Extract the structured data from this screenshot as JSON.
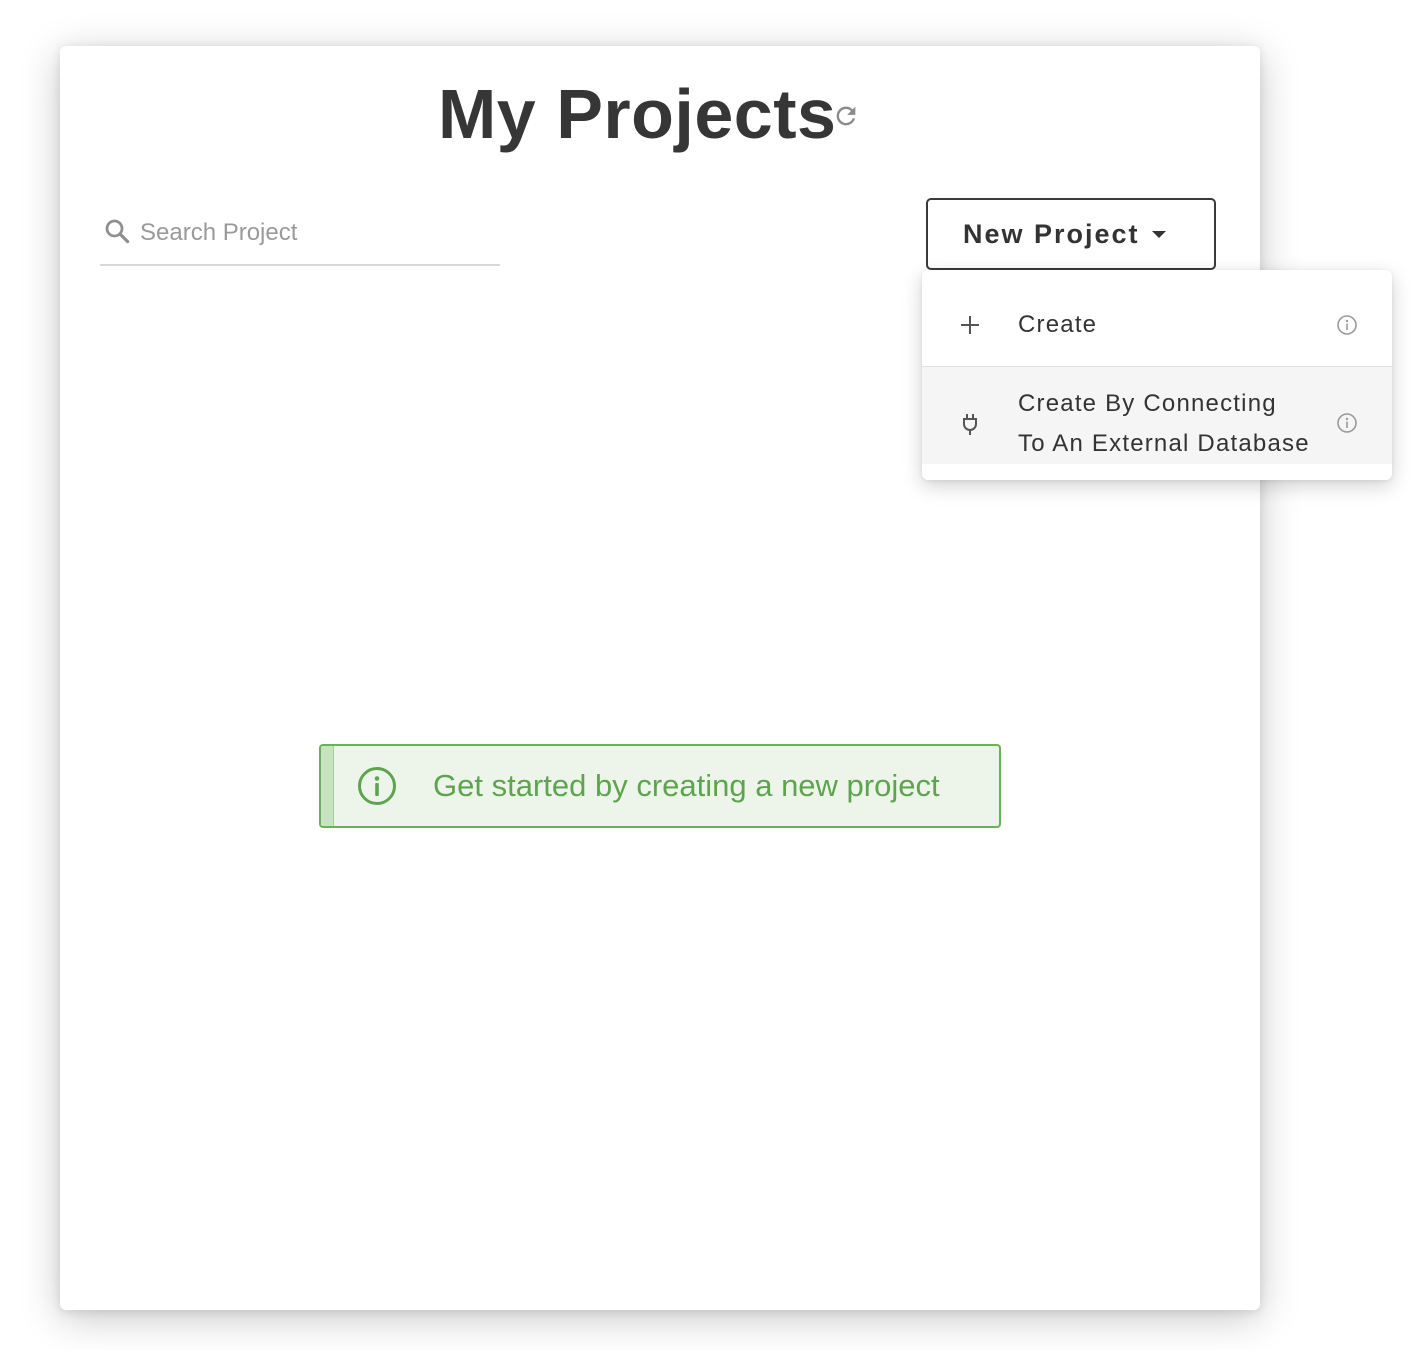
{
  "header": {
    "title": "My Projects",
    "refresh_icon": "refresh-icon"
  },
  "search": {
    "placeholder": "Search Project",
    "value": "",
    "icon": "search-icon"
  },
  "new_project": {
    "label": "New Project",
    "icon": "caret-down-icon"
  },
  "menu": {
    "items": [
      {
        "label": "Create",
        "icon": "plus-icon",
        "info_icon": "info-icon"
      },
      {
        "label_line1": "Create By Connecting",
        "label_line2": "To An External Database",
        "icon": "plug-icon",
        "info_icon": "info-icon"
      }
    ]
  },
  "notice": {
    "text": "Get started by creating a new project",
    "icon": "info-circle-icon",
    "color": "#5ea44e"
  },
  "colors": {
    "title": "#363636",
    "notice_bg": "#edf5ea",
    "notice_border": "#6ab05a",
    "menu_hover": "#f5f5f5"
  }
}
